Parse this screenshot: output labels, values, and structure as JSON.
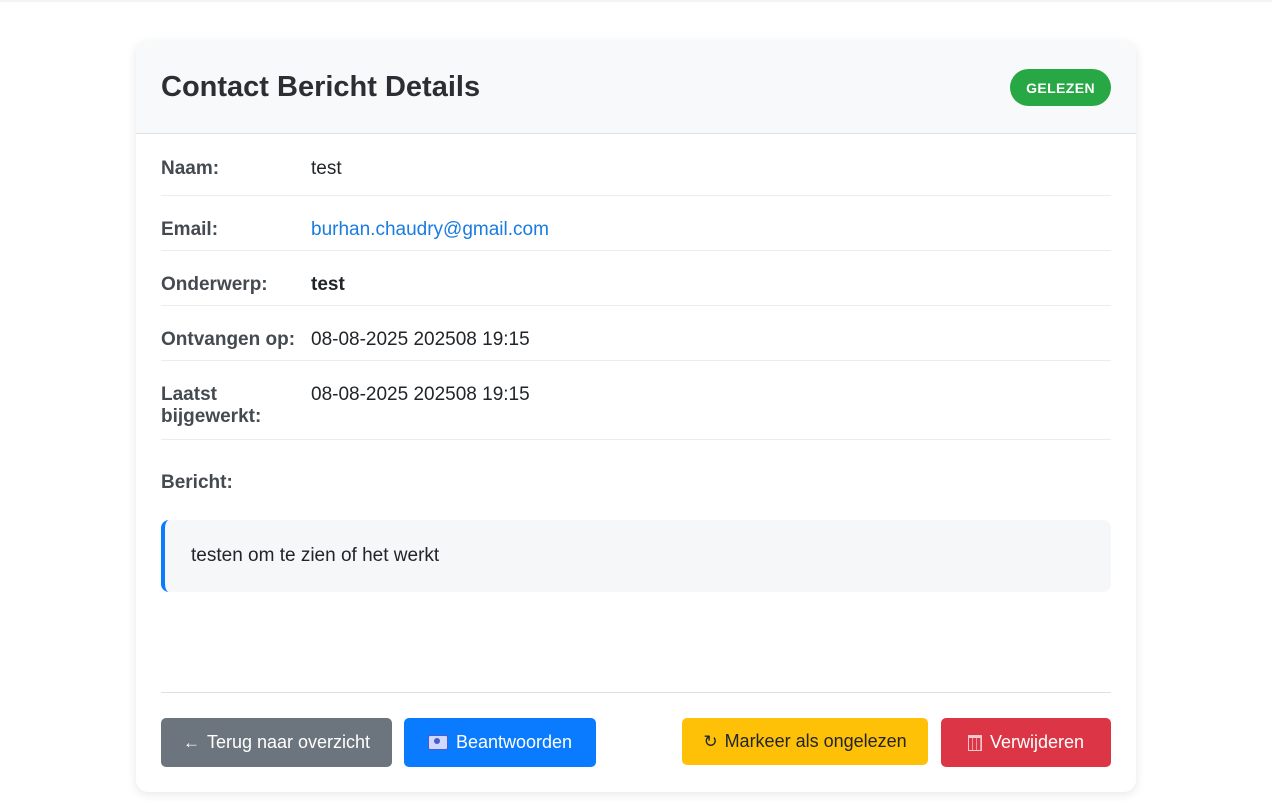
{
  "card": {
    "title": "Contact Bericht Details",
    "status_badge": "GELEZEN"
  },
  "details": [
    {
      "label": "Naam:",
      "value": "test"
    },
    {
      "label": "Email:",
      "value": "burhan.chaudry@gmail.com"
    },
    {
      "label": "Onderwerp:",
      "value": "test"
    },
    {
      "label": "Ontvangen op:",
      "value": "08-08-2025 202508 19:15"
    },
    {
      "label": "Laatst bijgewerkt:",
      "value": "08-08-2025 202508 19:15"
    }
  ],
  "message": {
    "label": "Bericht:",
    "body": "testen om te zien of het werkt"
  },
  "actions": {
    "back": {
      "icon": "←",
      "label": "Terug naar overzicht"
    },
    "reply": {
      "icon": "mail-icon",
      "label": "Beantwoorden"
    },
    "mark_unread": {
      "icon": "↻",
      "label": "Markeer als ongelezen"
    },
    "delete": {
      "icon": "trash-icon",
      "label": "Verwijderen"
    }
  },
  "colors": {
    "badge": "#28a745",
    "link": "#1a7be0",
    "back": "#6c757d",
    "reply": "#0a7bff",
    "mark": "#ffc107",
    "delete": "#dc3545"
  }
}
